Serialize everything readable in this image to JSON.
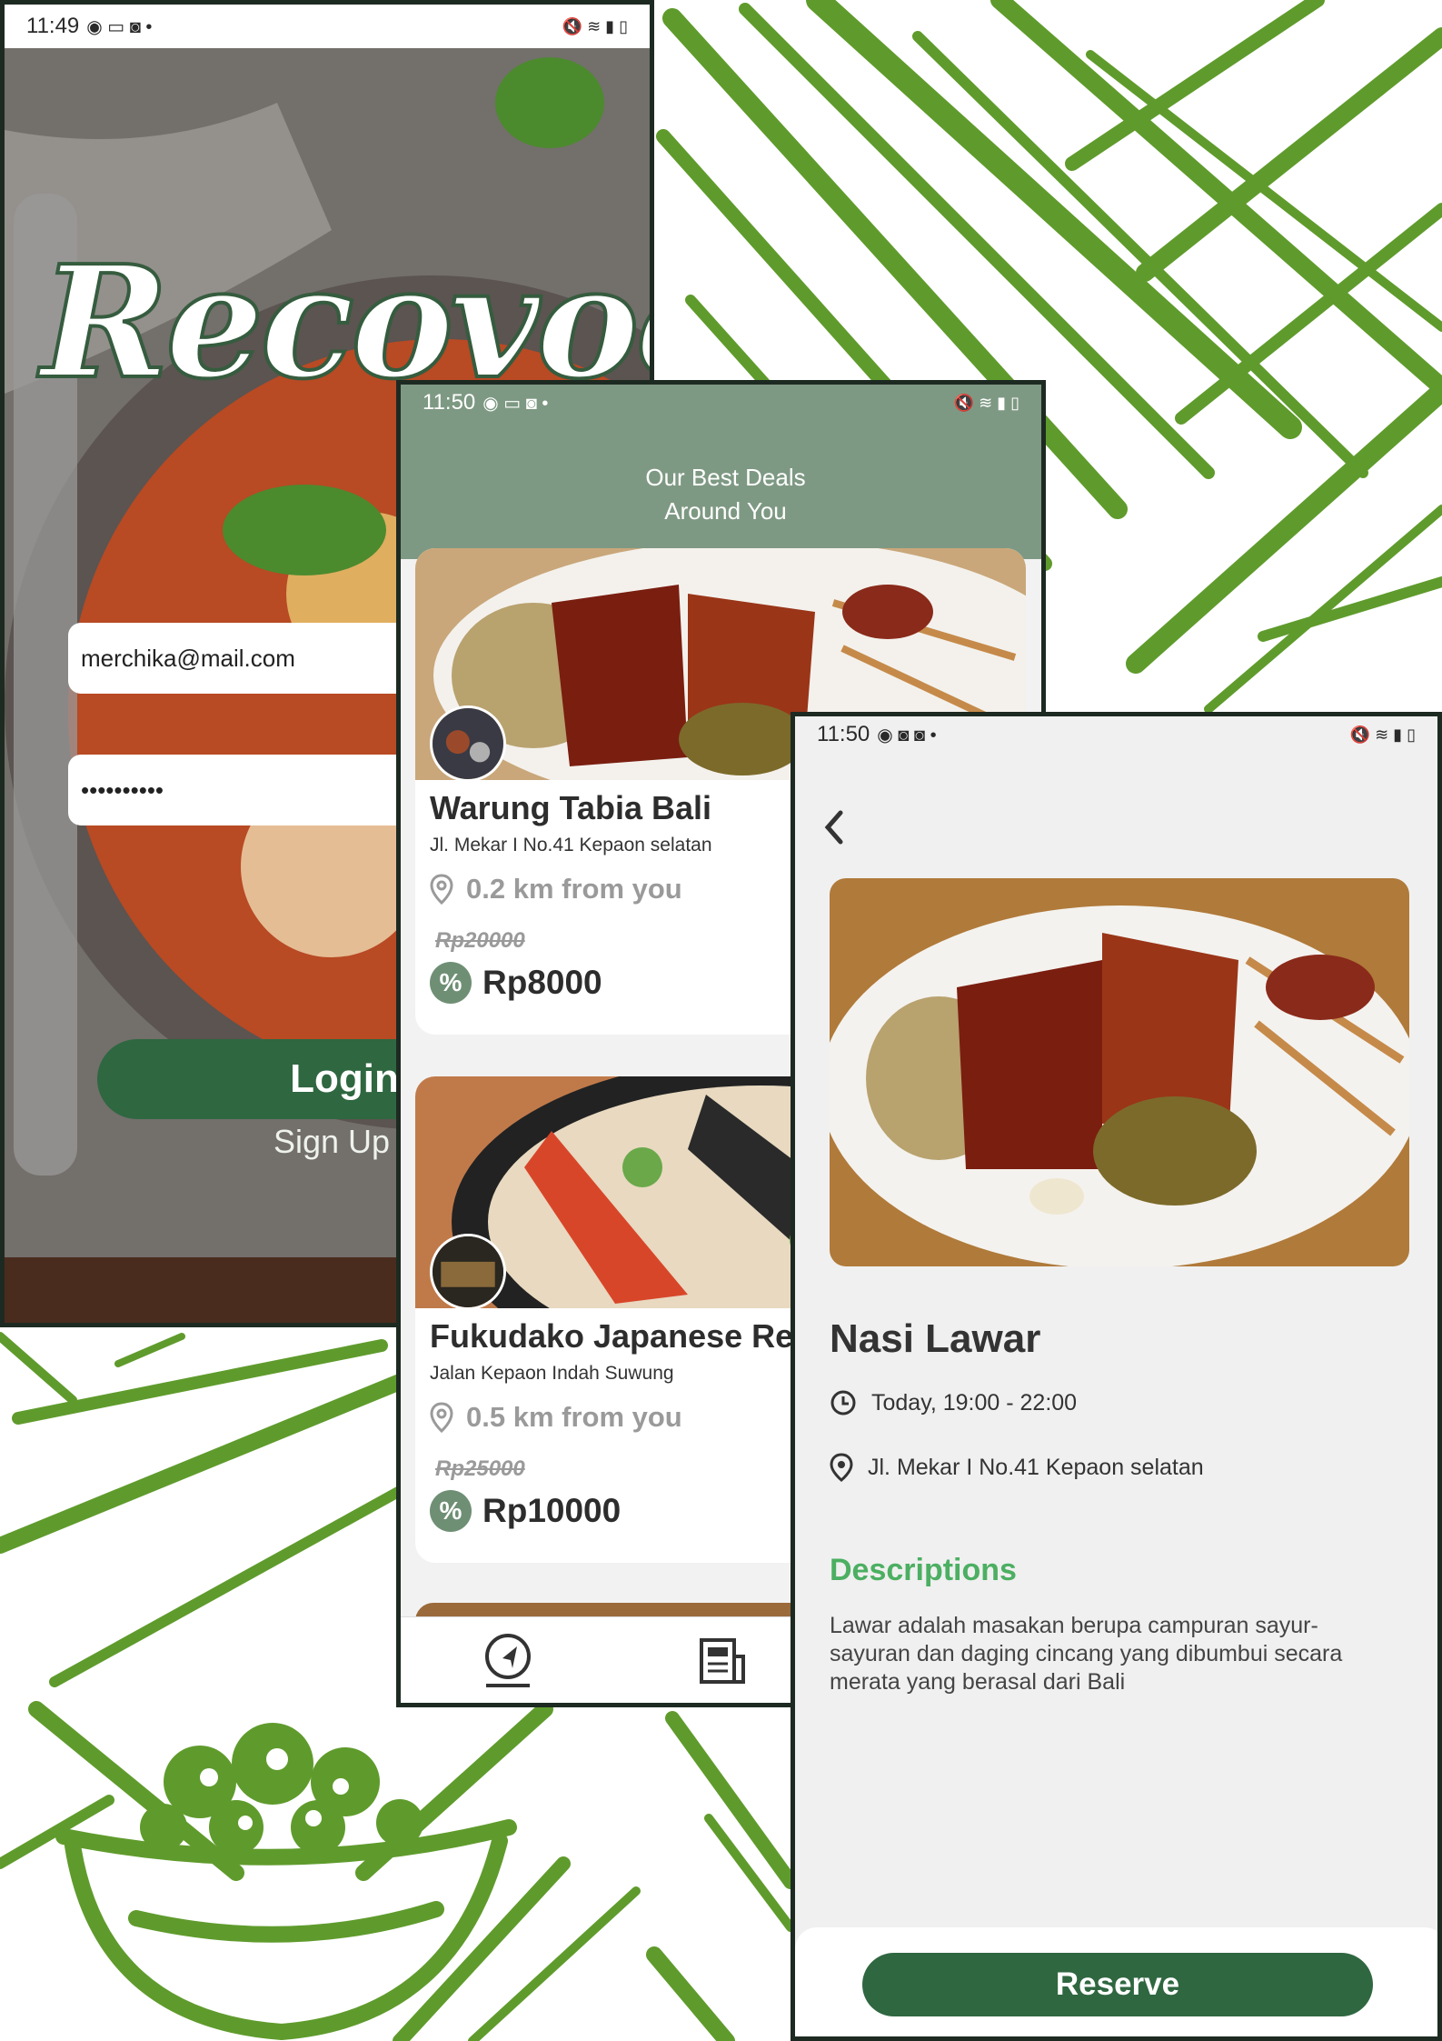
{
  "login_screen": {
    "status_time": "11:49",
    "logo": "Recovood",
    "email_value": "merchika@mail.com",
    "password_value": "••••••••••",
    "login_label": "Login",
    "signup_label": "Sign Up"
  },
  "deals_screen": {
    "status_time": "11:50",
    "header_line1": "Our Best Deals",
    "header_line2": "Around You",
    "deals": [
      {
        "name": "Warung Tabia Bali",
        "address": "Jl. Mekar I No.41 Kepaon selatan",
        "distance": "0.2 km from you",
        "old_price": "Rp20000",
        "new_price": "Rp8000"
      },
      {
        "name": "Fukudako Japanese Res",
        "address": "Jalan Kepaon Indah Suwung",
        "distance": "0.5 km from you",
        "old_price": "Rp25000",
        "new_price": "Rp10000"
      }
    ],
    "discount_symbol": "%"
  },
  "detail_screen": {
    "status_time": "11:50",
    "title": "Nasi Lawar",
    "time": "Today, 19:00 - 22:00",
    "address": "Jl. Mekar I No.41 Kepaon selatan",
    "desc_heading": "Descriptions",
    "desc_text": "Lawar adalah masakan berupa campuran sayur-sayuran dan daging cincang yang dibumbui secara merata yang berasal dari Bali",
    "reserve_label": "Reserve"
  },
  "colors": {
    "brand_green": "#2f6740",
    "header_sage": "#7e9983",
    "accent_green": "#4caf62",
    "stroke_green": "#5a9a2a"
  }
}
